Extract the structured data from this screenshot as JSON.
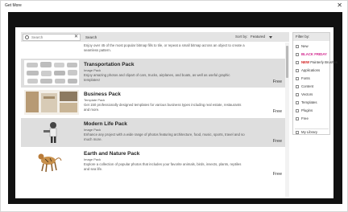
{
  "window": {
    "title": "Get More",
    "close_glyph": "✕"
  },
  "search": {
    "placeholder": "Search",
    "clear_glyph": "✕",
    "button_label": "Search"
  },
  "sort": {
    "label": "Sort by:",
    "selected": "Featured"
  },
  "items": [
    {
      "name": "",
      "type": "",
      "desc": "Enjoy over 45 of the most popular bitmap fills to tile, or repeat a small bitmap across an object to create a seamless pattern.",
      "price": "Free"
    },
    {
      "name": "Transportation Pack",
      "type": "Image Pack",
      "desc": "Enjoy amazing photos and clipart of cars, trucks, airplanes, and boats, as well as useful graphic templates!",
      "price": "Free"
    },
    {
      "name": "Business Pack",
      "type": "Template Pack",
      "desc": "Get 150 professionally designed templates for various business types including real estate, restaurants and more.",
      "price": "Free"
    },
    {
      "name": "Modern Life Pack",
      "type": "Image Pack",
      "desc": "Enhance any project with a wide range of photos featuring architecture, food, music, sports, travel and so much more.",
      "price": "Free"
    },
    {
      "name": "Earth and Nature Pack",
      "type": "Image Pack",
      "desc": "Explore a collection of popular photos that includes your favorite animals, birds, insects, plants, reptiles and sea life.",
      "price": "Free"
    }
  ],
  "filters": {
    "heading": "Filter by:",
    "items": [
      {
        "prefix": "",
        "label": "New",
        "style": ""
      },
      {
        "prefix": "",
        "label": "BLACK FRIDAY",
        "style": "pink"
      },
      {
        "prefix": "NEW",
        "label": " Painterly Brushes",
        "style": "red"
      },
      {
        "prefix": "",
        "label": "Applications",
        "style": ""
      },
      {
        "prefix": "",
        "label": "Fonts",
        "style": ""
      },
      {
        "prefix": "",
        "label": "Content",
        "style": ""
      },
      {
        "prefix": "",
        "label": "Vectors",
        "style": ""
      },
      {
        "prefix": "",
        "label": "Templates",
        "style": ""
      },
      {
        "prefix": "",
        "label": "Plugins",
        "style": ""
      },
      {
        "prefix": "",
        "label": "Free",
        "style": ""
      }
    ],
    "library": "My Library"
  },
  "colors": {
    "frame": "#111111",
    "shaded_row": "#dedede",
    "accent_red": "#d01818",
    "accent_pink": "#d0208a"
  }
}
